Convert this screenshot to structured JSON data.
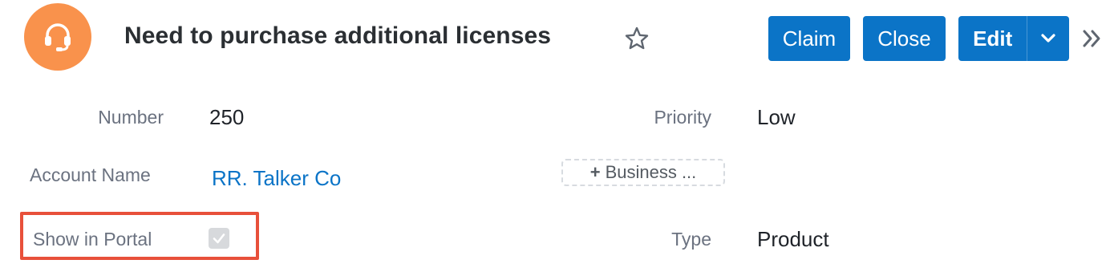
{
  "header": {
    "title": "Need to purchase additional licenses",
    "avatar_icon": "headset-icon",
    "avatar_color": "#f9924c",
    "favorite_icon": "star-outline-icon",
    "more_icon": "double-chevron-right-icon"
  },
  "actions": {
    "claim_label": "Claim",
    "close_label": "Close",
    "edit_label": "Edit",
    "dropdown_icon": "chevron-down-icon",
    "button_color": "#0b74c7"
  },
  "fields": {
    "number": {
      "label": "Number",
      "value": "250"
    },
    "priority": {
      "label": "Priority",
      "value": "Low"
    },
    "account_name": {
      "label": "Account Name",
      "value": "RR. Talker Co"
    },
    "business": {
      "label": "Business ..."
    },
    "show_in_portal": {
      "label": "Show in Portal",
      "checked": true
    },
    "type": {
      "label": "Type",
      "value": "Product"
    }
  },
  "highlight_color": "#e8503a"
}
